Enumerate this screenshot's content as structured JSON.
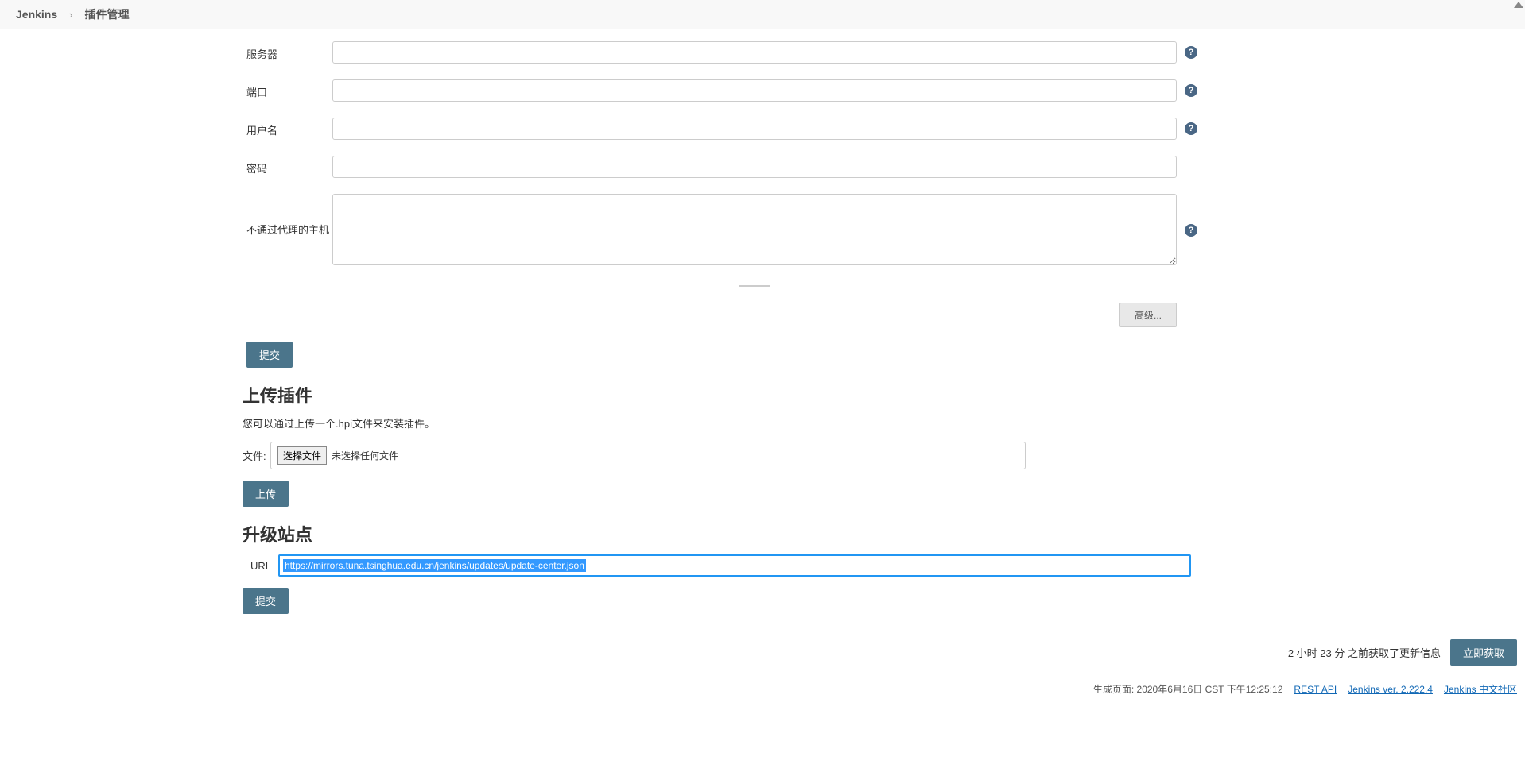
{
  "breadcrumb": {
    "root": "Jenkins",
    "current": "插件管理"
  },
  "proxy": {
    "server_label": "服务器",
    "server_value": "",
    "port_label": "端口",
    "port_value": "",
    "username_label": "用户名",
    "username_value": "",
    "password_label": "密码",
    "password_value": "",
    "noproxy_label": "不通过代理的主机",
    "noproxy_value": "",
    "advanced_button": "高级...",
    "submit_button": "提交"
  },
  "upload": {
    "title": "上传插件",
    "description": "您可以通过上传一个.hpi文件来安装插件。",
    "file_label": "文件:",
    "choose_button": "选择文件",
    "no_file_text": "未选择任何文件",
    "upload_button": "上传"
  },
  "update_site": {
    "title": "升级站点",
    "url_label": "URL",
    "url_value": "https://mirrors.tuna.tsinghua.edu.cn/jenkins/updates/update-center.json",
    "submit_button": "提交"
  },
  "status": {
    "last_check": "2 小时 23 分 之前获取了更新信息",
    "check_now_button": "立即获取"
  },
  "footer": {
    "page_generated": "生成页面: 2020年6月16日 CST 下午12:25:12",
    "rest_api": "REST API",
    "version": "Jenkins ver. 2.222.4",
    "community": "Jenkins 中文社区"
  }
}
